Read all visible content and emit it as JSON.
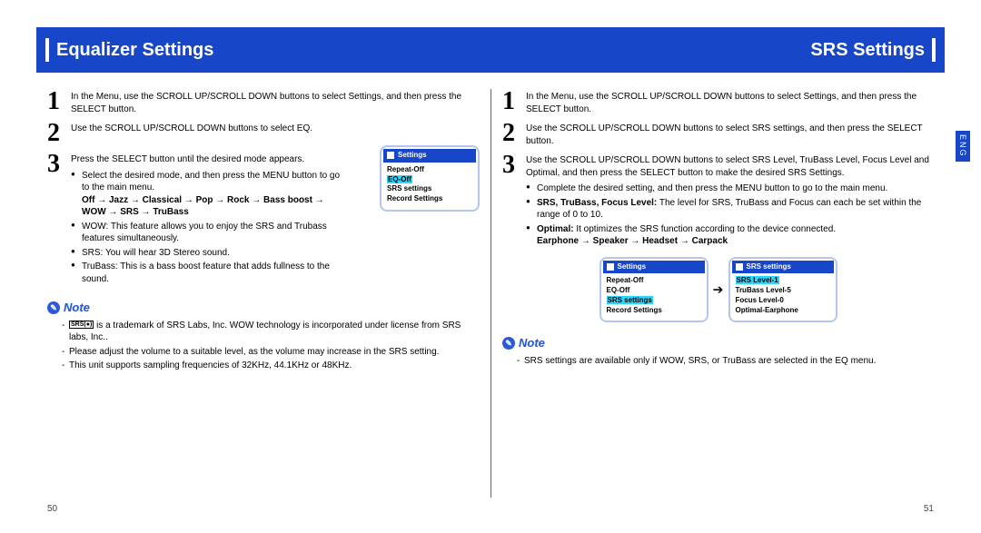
{
  "header": {
    "left": "Equalizer Settings",
    "right": "SRS Settings"
  },
  "eng_tab": "ENG",
  "pages": {
    "left": "50",
    "right": "51"
  },
  "left_col": {
    "s1": "In the Menu, use the SCROLL UP/SCROLL DOWN buttons to select Settings, and then press the SELECT button.",
    "s2": "Use the SCROLL UP/SCROLL DOWN buttons to select EQ.",
    "s3": "Press the SELECT button until the desired mode appears.",
    "s3_a": "Select the desired mode, and then press the MENU button to go to the main menu.",
    "s3_b": "Off → Jazz → Classical → Pop → Rock → Bass boost → WOW → SRS → TruBass",
    "wow": "WOW: This feature allows you to enjoy the SRS and Trubass features simultaneously.",
    "srs": "SRS: You will hear 3D Stereo sound.",
    "tru": "TruBass: This is a bass boost feature that adds fullness to the sound.",
    "note1": " is a trademark of SRS Labs, Inc. WOW technology is incorporated under license from SRS labs, Inc..",
    "note2": "Please adjust the volume to a suitable level, as the volume may increase in the SRS setting.",
    "note3": "This unit supports sampling frequencies of 32KHz, 44.1KHz or 48KHz.",
    "dev": {
      "title": "Settings",
      "r1": "Repeat-Off",
      "r2": "EQ-Off",
      "r3": "SRS settings",
      "r4": "Record Settings"
    }
  },
  "right_col": {
    "s1": "In the Menu, use the SCROLL UP/SCROLL DOWN buttons to select Settings, and then press the SELECT button.",
    "s2": "Use the SCROLL UP/SCROLL DOWN buttons to select SRS settings, and then press the SELECT button.",
    "s3": "Use the SCROLL UP/SCROLL DOWN buttons to select SRS Level, TruBass Level, Focus Level and Optimal, and then press the SELECT button to make the desired SRS Settings.",
    "b1": "Complete the desired setting, and then press the MENU button to go to the main menu.",
    "b2_lead": "SRS, TruBass, Focus Level:",
    "b2_rest": " The level for SRS, TruBass and Focus can each be set within the range of 0 to 10.",
    "b3_lead": "Optimal:",
    "b3_rest": " It optimizes the SRS function according to the device connected.",
    "b3_seq": "Earphone → Speaker → Headset → Carpack",
    "note1": "SRS settings are available only if WOW, SRS, or TruBass are selected in the EQ menu.",
    "devL": {
      "title": "Settings",
      "r1": "Repeat-Off",
      "r2": "EQ-Off",
      "r3": "SRS settings",
      "r4": "Record Settings"
    },
    "devR": {
      "title": "SRS settings",
      "r1": "SRS Level-1",
      "r2": "TruBass Level-5",
      "r3": "Focus Level-0",
      "r4": "Optimal-Earphone"
    }
  },
  "note_label": "Note"
}
